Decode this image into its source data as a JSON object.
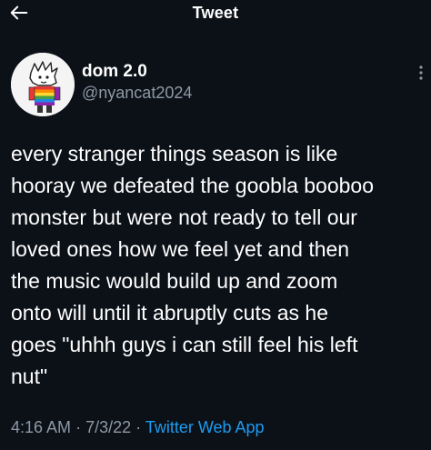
{
  "header": {
    "title": "Tweet",
    "back_icon": "arrow-left-icon"
  },
  "author": {
    "display_name": "dom 2.0",
    "handle": "@nyancat2024",
    "more_icon": "more-vertical-icon"
  },
  "tweet": {
    "lines": [
      "every stranger things season is like",
      "hooray we defeated the goobla booboo",
      "monster but were not ready to tell our",
      "loved ones how we feel yet and then",
      "the music would build up and zoom",
      "onto will until it abruptly cuts as he",
      "goes \"uhhh guys i can still feel his left",
      "nut\""
    ]
  },
  "meta": {
    "time": "4:16 AM",
    "separator": "·",
    "date": "7/3/22",
    "source": "Twitter Web App"
  },
  "colors": {
    "background": "#0c1118",
    "text": "#ffffff",
    "secondary_text": "#8d99a5",
    "link": "#1d9bf0"
  }
}
